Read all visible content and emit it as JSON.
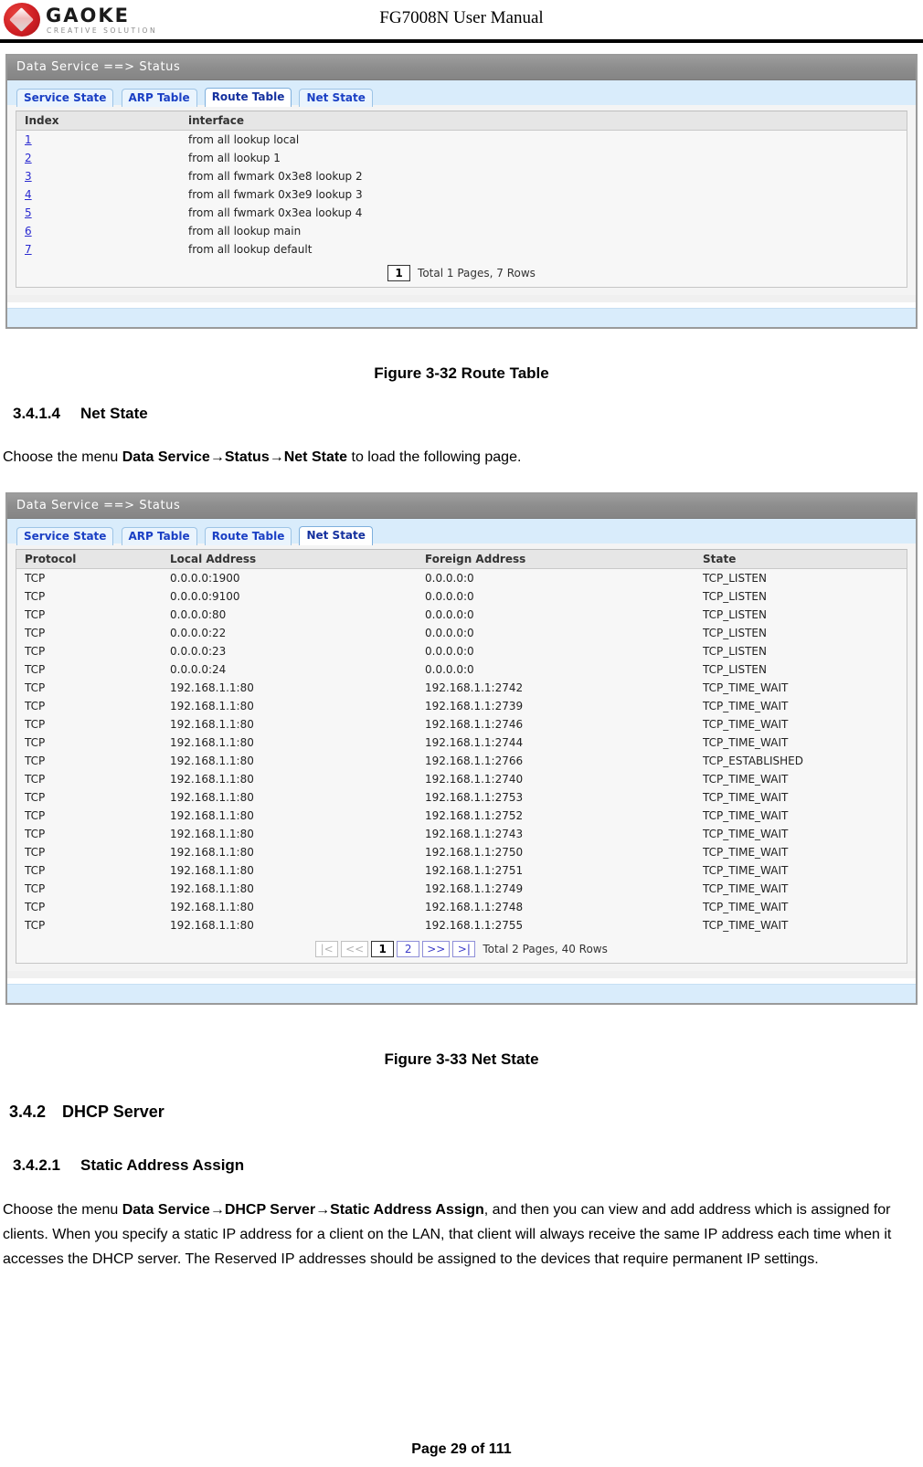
{
  "header": {
    "logo_word": "GAOKE",
    "logo_tagline": "CREATIVE SOLUTION",
    "title": "FG7008N User Manual"
  },
  "figure_route": {
    "panel_title": "Data Service ==> Status",
    "tabs": [
      {
        "label": "Service State",
        "active": false
      },
      {
        "label": "ARP Table",
        "active": false
      },
      {
        "label": "Route Table",
        "active": true
      },
      {
        "label": "Net State",
        "active": false
      }
    ],
    "columns": [
      "Index",
      "interface"
    ],
    "rows": [
      {
        "index": "1",
        "interface": "from all lookup local"
      },
      {
        "index": "2",
        "interface": "from all lookup 1"
      },
      {
        "index": "3",
        "interface": "from all fwmark 0x3e8 lookup 2"
      },
      {
        "index": "4",
        "interface": "from all fwmark 0x3e9 lookup 3"
      },
      {
        "index": "5",
        "interface": "from all fwmark 0x3ea lookup 4"
      },
      {
        "index": "6",
        "interface": "from all lookup main"
      },
      {
        "index": "7",
        "interface": "from all lookup default"
      }
    ],
    "pager": {
      "current_page": "1",
      "totals": "Total 1 Pages, 7 Rows"
    },
    "caption": "Figure 3-32  Route Table"
  },
  "section_net_state": {
    "number": "3.4.1.4",
    "title": "Net State",
    "intro_prefix": "Choose the menu ",
    "intro_path": "Data Service→Status→Net State",
    "intro_suffix": " to load the following page."
  },
  "figure_netstate": {
    "panel_title": "Data Service ==> Status",
    "tabs": [
      {
        "label": "Service State",
        "active": false
      },
      {
        "label": "ARP Table",
        "active": false
      },
      {
        "label": "Route Table",
        "active": false
      },
      {
        "label": "Net State",
        "active": true
      }
    ],
    "columns": [
      "Protocol",
      "Local Address",
      "Foreign Address",
      "State"
    ],
    "rows": [
      {
        "protocol": "TCP",
        "local": "0.0.0.0:1900",
        "foreign": "0.0.0.0:0",
        "state": "TCP_LISTEN"
      },
      {
        "protocol": "TCP",
        "local": "0.0.0.0:9100",
        "foreign": "0.0.0.0:0",
        "state": "TCP_LISTEN"
      },
      {
        "protocol": "TCP",
        "local": "0.0.0.0:80",
        "foreign": "0.0.0.0:0",
        "state": "TCP_LISTEN"
      },
      {
        "protocol": "TCP",
        "local": "0.0.0.0:22",
        "foreign": "0.0.0.0:0",
        "state": "TCP_LISTEN"
      },
      {
        "protocol": "TCP",
        "local": "0.0.0.0:23",
        "foreign": "0.0.0.0:0",
        "state": "TCP_LISTEN"
      },
      {
        "protocol": "TCP",
        "local": "0.0.0.0:24",
        "foreign": "0.0.0.0:0",
        "state": "TCP_LISTEN"
      },
      {
        "protocol": "TCP",
        "local": "192.168.1.1:80",
        "foreign": "192.168.1.1:2742",
        "state": "TCP_TIME_WAIT"
      },
      {
        "protocol": "TCP",
        "local": "192.168.1.1:80",
        "foreign": "192.168.1.1:2739",
        "state": "TCP_TIME_WAIT"
      },
      {
        "protocol": "TCP",
        "local": "192.168.1.1:80",
        "foreign": "192.168.1.1:2746",
        "state": "TCP_TIME_WAIT"
      },
      {
        "protocol": "TCP",
        "local": "192.168.1.1:80",
        "foreign": "192.168.1.1:2744",
        "state": "TCP_TIME_WAIT"
      },
      {
        "protocol": "TCP",
        "local": "192.168.1.1:80",
        "foreign": "192.168.1.1:2766",
        "state": "TCP_ESTABLISHED"
      },
      {
        "protocol": "TCP",
        "local": "192.168.1.1:80",
        "foreign": "192.168.1.1:2740",
        "state": "TCP_TIME_WAIT"
      },
      {
        "protocol": "TCP",
        "local": "192.168.1.1:80",
        "foreign": "192.168.1.1:2753",
        "state": "TCP_TIME_WAIT"
      },
      {
        "protocol": "TCP",
        "local": "192.168.1.1:80",
        "foreign": "192.168.1.1:2752",
        "state": "TCP_TIME_WAIT"
      },
      {
        "protocol": "TCP",
        "local": "192.168.1.1:80",
        "foreign": "192.168.1.1:2743",
        "state": "TCP_TIME_WAIT"
      },
      {
        "protocol": "TCP",
        "local": "192.168.1.1:80",
        "foreign": "192.168.1.1:2750",
        "state": "TCP_TIME_WAIT"
      },
      {
        "protocol": "TCP",
        "local": "192.168.1.1:80",
        "foreign": "192.168.1.1:2751",
        "state": "TCP_TIME_WAIT"
      },
      {
        "protocol": "TCP",
        "local": "192.168.1.1:80",
        "foreign": "192.168.1.1:2749",
        "state": "TCP_TIME_WAIT"
      },
      {
        "protocol": "TCP",
        "local": "192.168.1.1:80",
        "foreign": "192.168.1.1:2748",
        "state": "TCP_TIME_WAIT"
      },
      {
        "protocol": "TCP",
        "local": "192.168.1.1:80",
        "foreign": "192.168.1.1:2755",
        "state": "TCP_TIME_WAIT"
      }
    ],
    "pager": {
      "first_label": "|<",
      "prev_label": "<<",
      "page_1": "1",
      "page_2": "2",
      "next_label": ">>",
      "last_label": ">|",
      "totals": "Total 2 Pages, 40 Rows"
    },
    "caption": "Figure 3-33  Net State"
  },
  "section_dhcp": {
    "number": "3.4.2",
    "title": "DHCP Server"
  },
  "section_static": {
    "number": "3.4.2.1",
    "title": "Static Address Assign",
    "para_prefix": "Choose the menu ",
    "para_path": "Data Service→DHCP Server→Static Address Assign",
    "para_rest": ", and then you can view and add address which is assigned for clients. When you specify a static IP address for a client on the LAN, that client will always receive the same IP address each time when it accesses the DHCP server. The Reserved IP addresses should be assigned to the devices that require permanent IP settings."
  },
  "footer": {
    "page_label": "Page 29 of 111"
  }
}
